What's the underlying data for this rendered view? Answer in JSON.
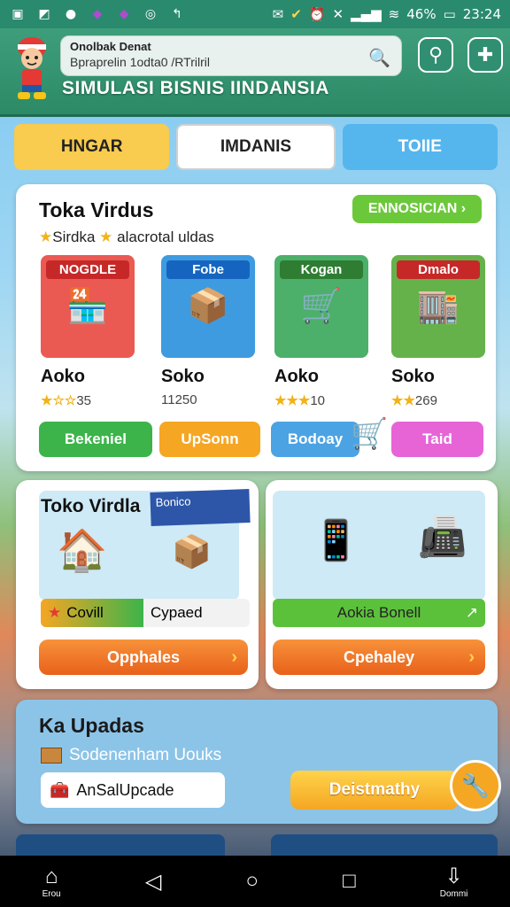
{
  "status": {
    "time": "23:24",
    "battery": "46%",
    "icons": [
      "screen-icon",
      "image-icon",
      "dot-icon",
      "app-icon",
      "app-icon",
      "whatsapp-icon",
      "call-icon",
      "mail-icon",
      "check-icon",
      "alarm-icon",
      "mute-icon",
      "signal-icon",
      "wifi-icon"
    ]
  },
  "header": {
    "search_line1": "Onolbak Denat",
    "search_line2": "Bpraprelin 1odta0 /RTrilril",
    "title": "SIMULASI BISNIS IINDANSIA",
    "accent": "#2c8a66"
  },
  "tabs": [
    {
      "label": "HNGAR",
      "color": "#f9cb4e"
    },
    {
      "label": "IMDANIS",
      "color": "#ffffff"
    },
    {
      "label": "TOIIE",
      "color": "#55b6ee"
    }
  ],
  "store": {
    "title": "Toka Virdus",
    "subtitle": "Sirdka",
    "subtitle2": "alacrotal uldas",
    "badge": "ENNOSICIAN",
    "products": [
      {
        "tag": "NOGDLE",
        "name": "Aoko",
        "stars": "★☆☆",
        "rating": "35",
        "icon": "🏪",
        "bg": "#ea5a52"
      },
      {
        "tag": "Fobe",
        "name": "Soko",
        "stars": "",
        "rating": "11250",
        "icon": "📦",
        "bg": "#3f9be0"
      },
      {
        "tag": "Kogan",
        "name": "Aoko",
        "stars": "★★★",
        "rating": "10",
        "icon": "🛒",
        "bg": "#4cb06a"
      },
      {
        "tag": "Dmalo",
        "name": "Soko",
        "stars": "★★",
        "rating": "269",
        "icon": "🏬",
        "bg": "#66b24a"
      }
    ],
    "actions": [
      {
        "label": "Bekeniel",
        "bg": "#3cb44a"
      },
      {
        "label": "UpSonn",
        "bg": "#f5a623"
      },
      {
        "label": "Bodoay",
        "bg": "#4ba3e3"
      },
      {
        "label": "Taid",
        "bg": "#e764d7"
      }
    ]
  },
  "left": {
    "title": "Toko Virdla",
    "tag": "Bonico",
    "bar_left": "Covill",
    "bar_right": "Cypaed",
    "button": "Opphales"
  },
  "right": {
    "bar": "Aokia Bonell",
    "button": "Cpehaley"
  },
  "update": {
    "title": "Ka Upadas",
    "subtitle": "Sodenenham Uouks",
    "box": "AnSalUpcade",
    "button": "Deistmathy"
  },
  "nav": [
    {
      "label": "Erou",
      "icon": "⌂"
    },
    {
      "label": "",
      "icon": "◁"
    },
    {
      "label": "",
      "icon": "○"
    },
    {
      "label": "",
      "icon": "□"
    },
    {
      "label": "Dommi",
      "icon": "⇩"
    }
  ]
}
